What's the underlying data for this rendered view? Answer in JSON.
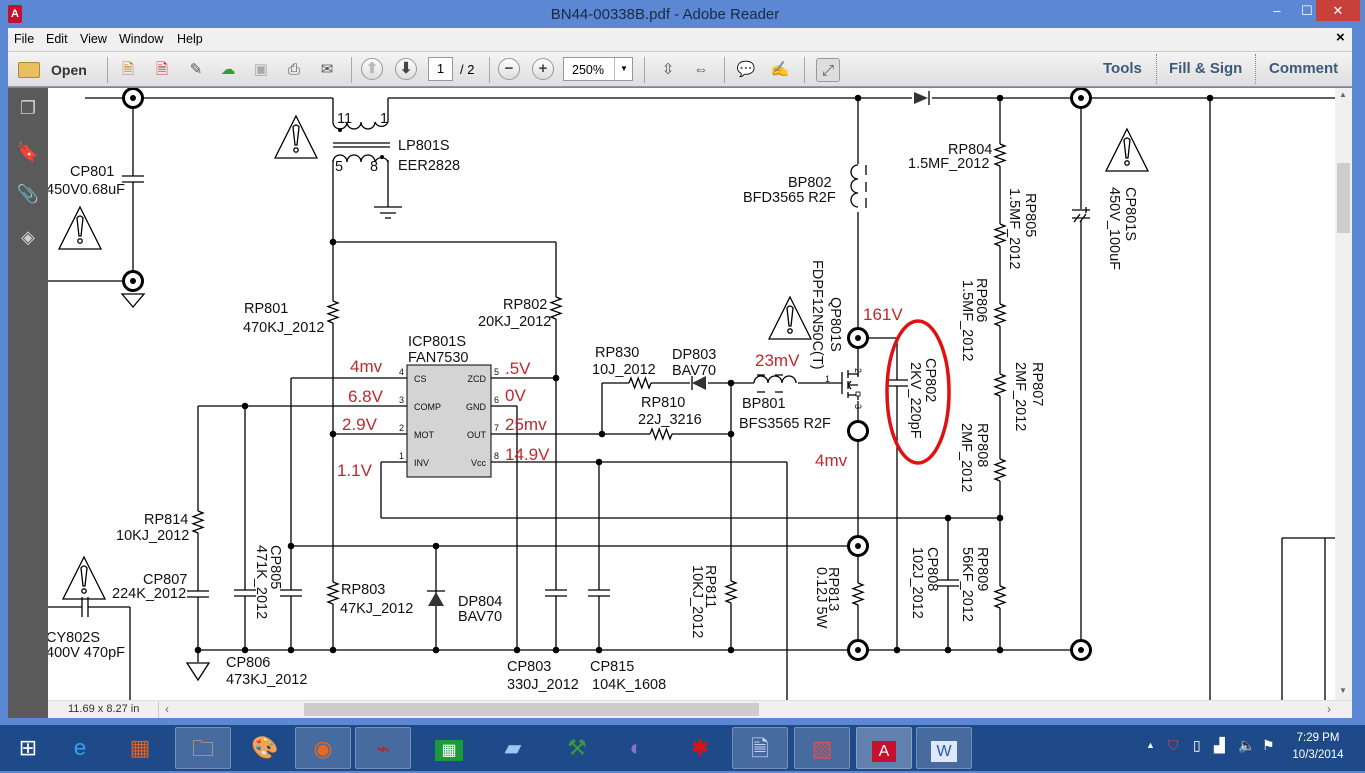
{
  "window": {
    "title": "BN44-00338B.pdf - Adobe Reader",
    "app_icon": "acrobat-icon",
    "minimize": "–",
    "maximize": "☐",
    "close": "✕"
  },
  "menu": {
    "items": [
      "File",
      "Edit",
      "View",
      "Window",
      "Help"
    ],
    "close_doc": "×"
  },
  "toolbar": {
    "open_label": "Open",
    "page_current": "1",
    "page_total": "/ 2",
    "zoom_value": "250%",
    "tools": "Tools",
    "fill_sign": "Fill & Sign",
    "comment": "Comment"
  },
  "status": {
    "page_size": "11.69 x 8.27 in"
  },
  "taskbar": {
    "time": "7:29 PM",
    "date": "10/3/2014"
  },
  "colors": {
    "titlebar": "#5b87d3",
    "voltage": "#c0282d",
    "annotation_ellipse": "#e01010",
    "taskbar": "#1f4a8a"
  },
  "schematic": {
    "parts": [
      {
        "ref": "CP801",
        "value": "450V0.68uF"
      },
      {
        "ref": "LP801S",
        "value": "EER2828"
      },
      {
        "ref": "RP801",
        "value": "470KJ_2012"
      },
      {
        "ref": "RP802",
        "value": "20KJ_2012"
      },
      {
        "ref": "ICP801S",
        "value": "FAN7530"
      },
      {
        "ref": "RP830",
        "value": "10J_2012"
      },
      {
        "ref": "DP803",
        "value": "BAV70"
      },
      {
        "ref": "RP810",
        "value": "22J_3216"
      },
      {
        "ref": "BP801",
        "value": "BFS3565 R2F"
      },
      {
        "ref": "BP802",
        "value": "BFD3565 R2F"
      },
      {
        "ref": "RP804",
        "value": "1.5MF_2012"
      },
      {
        "ref": "QP801S",
        "value": "FDPF12N50C(T)"
      },
      {
        "ref": "RP805",
        "value": "1.5MF_2012"
      },
      {
        "ref": "RP806",
        "value": "1.5MF_2012"
      },
      {
        "ref": "RP807",
        "value": "2MF_2012"
      },
      {
        "ref": "RP808",
        "value": "2MF_2012"
      },
      {
        "ref": "CP801S",
        "value": "450V_100uF"
      },
      {
        "ref": "CP802",
        "value": "2KV_220pF"
      },
      {
        "ref": "RP814",
        "value": "10KJ_2012"
      },
      {
        "ref": "CP807",
        "value": "224K_2012"
      },
      {
        "ref": "CY802S",
        "value": "400V 470pF"
      },
      {
        "ref": "CP805",
        "value": "471K_2012"
      },
      {
        "ref": "CP806",
        "value": "473KJ_2012"
      },
      {
        "ref": "RP803",
        "value": "47KJ_2012"
      },
      {
        "ref": "DP804",
        "value": "BAV70"
      },
      {
        "ref": "CP803",
        "value": "330J_2012"
      },
      {
        "ref": "CP815",
        "value": "104K_1608"
      },
      {
        "ref": "RP811",
        "value": "10KJ_2012"
      },
      {
        "ref": "RP813",
        "value": "0.12J 5W"
      },
      {
        "ref": "CP808",
        "value": "102J_2012"
      },
      {
        "ref": "RP809",
        "value": "56KF_2012"
      }
    ],
    "transformer_pins": [
      "11",
      "1",
      "5",
      "8"
    ],
    "ic_pins": [
      {
        "num": "4",
        "name": "CS"
      },
      {
        "num": "3",
        "name": "COMP"
      },
      {
        "num": "2",
        "name": "MOT"
      },
      {
        "num": "1",
        "name": "INV"
      },
      {
        "num": "5",
        "name": "ZCD"
      },
      {
        "num": "6",
        "name": "GND"
      },
      {
        "num": "7",
        "name": "OUT"
      },
      {
        "num": "8",
        "name": "Vcc"
      }
    ],
    "mosfet_pins": [
      "1",
      "2",
      "3"
    ],
    "voltages": [
      "4mv",
      "6.8V",
      "2.9V",
      "1.1V",
      ".5V",
      "0V",
      "25mv",
      "14.9V",
      "161V",
      "23mV",
      "4mv"
    ]
  }
}
